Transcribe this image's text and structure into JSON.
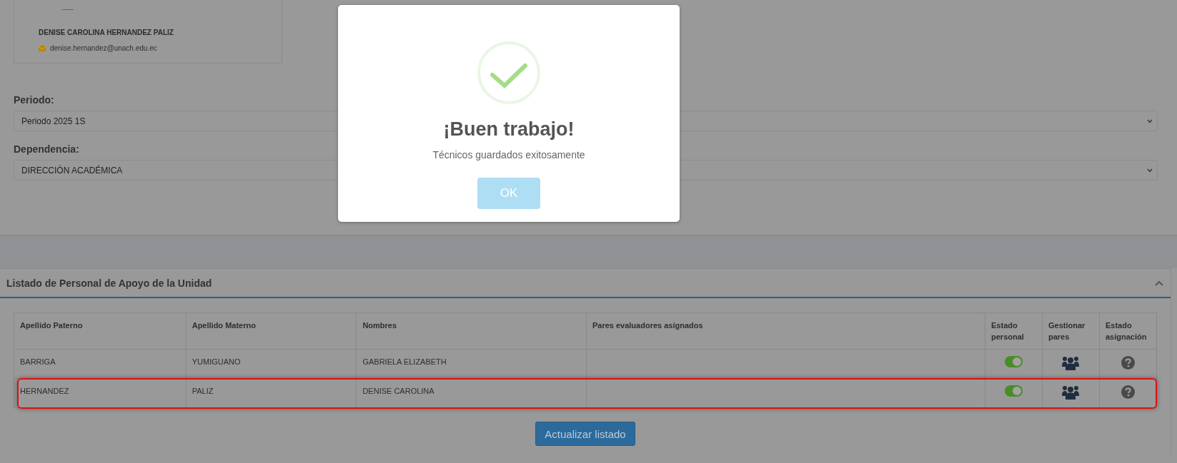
{
  "profile": {
    "name": "DENISE CAROLINA HERNANDEZ PALIZ",
    "email": "denise.hernandez@unach.edu.ec"
  },
  "form": {
    "fields": [
      {
        "label": "Periodo:",
        "value": "Periodo 2025 1S"
      },
      {
        "label": "Dependencia:",
        "value": "DIRECCIÓN ACADÉMICA"
      }
    ]
  },
  "panel": {
    "title": "Listado de Personal de Apoyo de la Unidad",
    "expanded": true,
    "table": {
      "columns": [
        "Apellido Paterno",
        "Apellido Materno",
        "Nombres",
        "Pares evaluadores asignados",
        "Estado personal",
        "Gestionar pares",
        "Estado asignación"
      ],
      "rows": [
        {
          "apellido_paterno": "BARRIGA",
          "apellido_materno": "YUMIGUANO",
          "nombres": "GABRIELA ELIZABETH",
          "estado_personal": true,
          "highlighted": false
        },
        {
          "apellido_paterno": "HERNANDEZ",
          "apellido_materno": "PALIZ",
          "nombres": "DENISE CAROLINA",
          "estado_personal": true,
          "highlighted": true
        }
      ]
    },
    "button": "Actualizar listado"
  },
  "dialog": {
    "title": "¡Buen trabajo!",
    "message": "Técnicos guardados exitosamente",
    "button": "OK"
  }
}
